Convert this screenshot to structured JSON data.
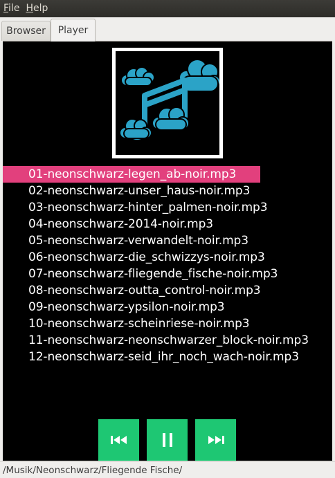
{
  "menubar": {
    "items": [
      {
        "mnemonic": "F",
        "rest": "ile"
      },
      {
        "mnemonic": "H",
        "rest": "elp"
      }
    ]
  },
  "tabs": [
    {
      "label": "Browser",
      "active": false
    },
    {
      "label": "Player",
      "active": true
    }
  ],
  "player": {
    "cover_icon": "music-note-clouds-icon",
    "selected_index": 0,
    "tracks": [
      "01-neonschwarz-legen_ab-noir.mp3",
      "02-neonschwarz-unser_haus-noir.mp3",
      "03-neonschwarz-hinter_palmen-noir.mp3",
      "04-neonschwarz-2014-noir.mp3",
      "05-neonschwarz-verwandelt-noir.mp3",
      "06-neonschwarz-die_schwizzys-noir.mp3",
      "07-neonschwarz-fliegende_fische-noir.mp3",
      "08-neonschwarz-outta_control-noir.mp3",
      "09-neonschwarz-ypsilon-noir.mp3",
      "10-neonschwarz-scheinriese-noir.mp3",
      "11-neonschwarz-neonschwarzer_block-noir.mp3",
      "12-neonschwarz-seid_ihr_noch_wach-noir.mp3"
    ],
    "controls": {
      "prev_icon": "skip-previous-icon",
      "pause_icon": "pause-icon",
      "next_icon": "skip-next-icon"
    }
  },
  "colors": {
    "selection": "#e2407d",
    "control_button": "#1ec773",
    "cover_accent": "#2ba3c7"
  },
  "statusbar": {
    "path": "/Musik/Neonschwarz/Fliegende Fische/"
  }
}
